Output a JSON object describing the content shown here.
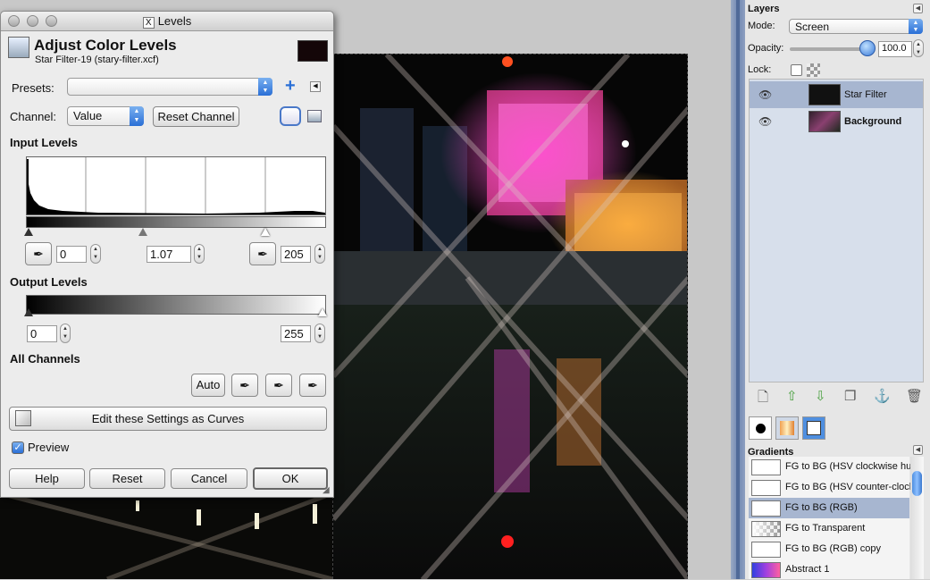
{
  "dialog": {
    "window_title": "Levels",
    "heading": "Adjust Color Levels",
    "subheading": "Star Filter-19 (stary-filter.xcf)",
    "presets_label": "Presets:",
    "presets_value": "",
    "channel_label": "Channel:",
    "channel_value": "Value",
    "reset_channel_label": "Reset Channel",
    "input_levels_label": "Input Levels",
    "input_low": "0",
    "input_gamma": "1.07",
    "input_high": "205",
    "output_levels_label": "Output Levels",
    "output_low": "0",
    "output_high": "255",
    "all_channels_label": "All Channels",
    "auto_label": "Auto",
    "curves_label": "Edit these Settings as Curves",
    "preview_label": "Preview",
    "preview_checked": true,
    "help_label": "Help",
    "reset_label": "Reset",
    "cancel_label": "Cancel",
    "ok_label": "OK"
  },
  "layers_panel": {
    "title": "Layers",
    "mode_label": "Mode:",
    "mode_value": "Screen",
    "opacity_label": "Opacity:",
    "opacity_value": "100.0",
    "opacity_fraction": 1.0,
    "lock_label": "Lock:",
    "layers": [
      {
        "name": "Star Filter",
        "visible": true,
        "selected": true
      },
      {
        "name": "Background",
        "visible": true,
        "selected": false
      }
    ]
  },
  "gradients_panel": {
    "title": "Gradients",
    "items": [
      {
        "name": "FG to BG (HSV clockwise hue)",
        "selected": false
      },
      {
        "name": "FG to BG (HSV counter-clockwise)",
        "selected": false
      },
      {
        "name": "FG to BG (RGB)",
        "selected": true
      },
      {
        "name": "FG to Transparent",
        "selected": false
      },
      {
        "name": "FG to BG (RGB) copy",
        "selected": false
      },
      {
        "name": "Abstract 1",
        "selected": false
      }
    ]
  },
  "colors": {
    "selection": "#a7b6d0",
    "accent_blue": "#2a6fd6"
  }
}
